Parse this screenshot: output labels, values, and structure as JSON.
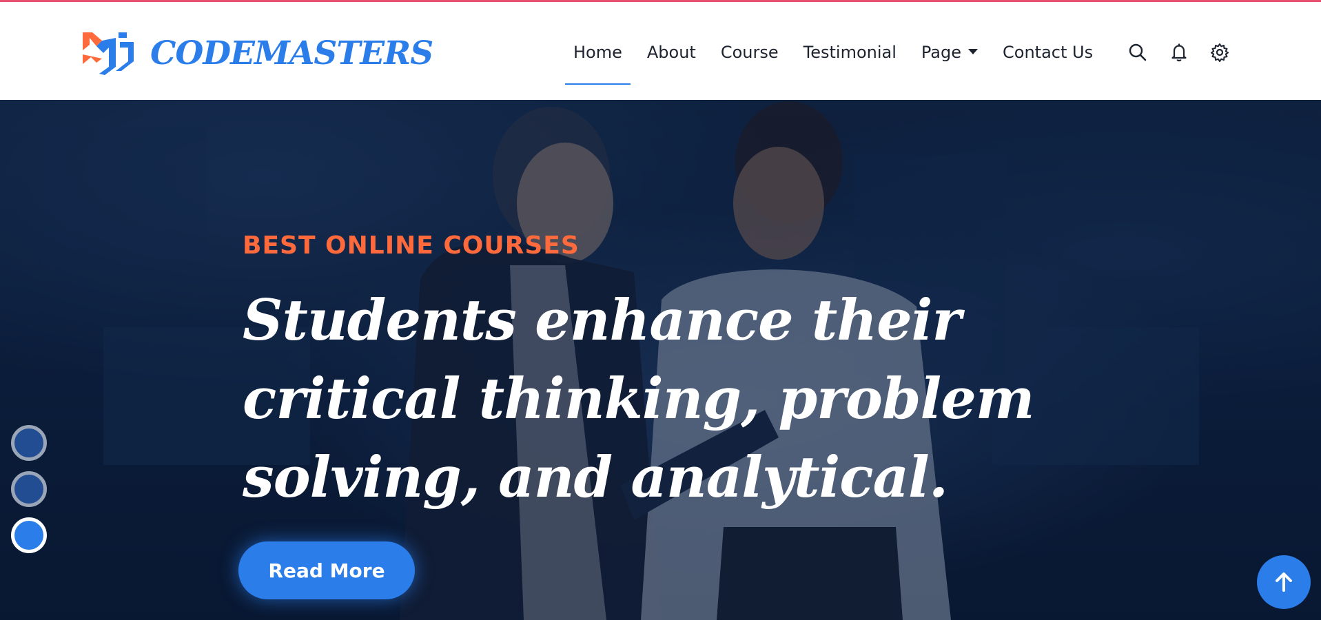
{
  "brand": {
    "name": "CODEMASTERS",
    "logo_icon": "cm-monogram-logo"
  },
  "nav": {
    "items": [
      {
        "label": "Home",
        "active": true
      },
      {
        "label": "About",
        "active": false
      },
      {
        "label": "Course",
        "active": false
      },
      {
        "label": "Testimonial",
        "active": false
      },
      {
        "label": "Page",
        "active": false,
        "has_dropdown": true
      },
      {
        "label": "Contact Us",
        "active": false
      }
    ],
    "icons": [
      "search-icon",
      "bell-icon",
      "gear-icon"
    ]
  },
  "hero": {
    "eyebrow": "BEST ONLINE COURSES",
    "headline": "Students enhance their critical thinking, problem solving, and analytical.",
    "cta_label": "Read More",
    "slider": {
      "total": 3,
      "active_index": 2
    }
  },
  "colors": {
    "accent": "#2b7de9",
    "eyebrow": "#ff6a3d",
    "top_accent": "#e8506f",
    "hero_bg": "#0e2040"
  },
  "back_to_top": {
    "icon": "arrow-up-icon"
  }
}
